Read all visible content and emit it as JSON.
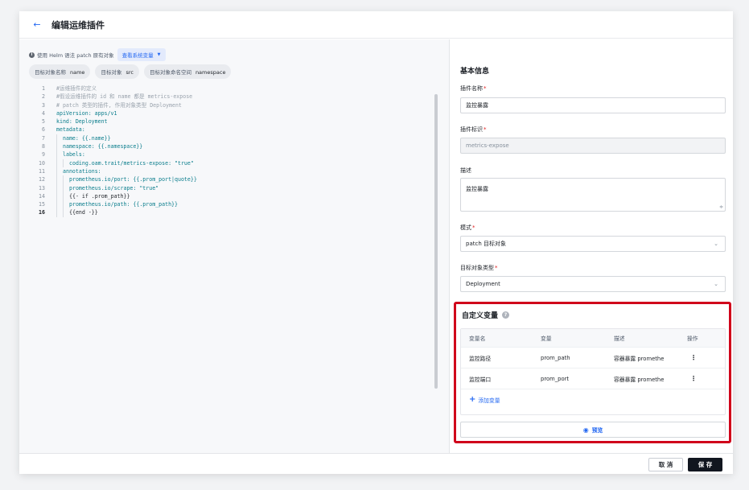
{
  "header": {
    "back_icon": "arrow-left-icon",
    "title": "编辑运维插件"
  },
  "left": {
    "hint": "使用 Helm 语法 patch 原有对象",
    "sysvar_button": "查看系统变量",
    "chips": [
      {
        "label": "目标对象名称",
        "value": "name"
      },
      {
        "label": "目标对象",
        "value": "src"
      },
      {
        "label": "目标对象命名空间",
        "value": "namespace"
      }
    ],
    "code": [
      "#运维插件的定义",
      "#假设运维插件的 id 和 name 都是 metrics-expose",
      "# patch 类型的插件, 作用对象类型 Deployment",
      "apiVersion: apps/v1",
      "kind: Deployment",
      "metadata:",
      "name: {{.name}}",
      "namespace: {{.namespace}}",
      "labels:",
      "coding.oam.trait/metrics-expose: \"true\"",
      "annotations:",
      "prometheus.io/port: {{.prom_port|quote}}",
      "prometheus.io/scrape: \"true\"",
      "{{- if .prom_path}}",
      "prometheus.io/path: {{.prom_path}}",
      "{{end -}}"
    ]
  },
  "right": {
    "section_title": "基本信息",
    "plugin_name_label": "插件名称",
    "plugin_name_value": "监控暴露",
    "plugin_id_label": "插件标识",
    "plugin_id_value": "metrics-expose",
    "desc_label": "描述",
    "desc_value": "监控暴露",
    "mode_label": "模式",
    "mode_value": "patch 目标对象",
    "target_type_label": "目标对象类型",
    "target_type_value": "Deployment",
    "custom_vars": {
      "title": "自定义变量",
      "columns": [
        "变量名",
        "变量",
        "描述",
        "操作"
      ],
      "rows": [
        {
          "name": "监控路径",
          "var": "prom_path",
          "desc": "容器暴露 promethe"
        },
        {
          "name": "监控端口",
          "var": "prom_port",
          "desc": "容器暴露 promethe"
        }
      ],
      "add_label": "添加变量",
      "preview_label": "预览"
    }
  },
  "footer": {
    "cancel_label": "取 消",
    "save_label": "保 存"
  },
  "colors": {
    "accent": "#2468f2",
    "highlight_border": "#d0021b",
    "save_bg": "#11161f"
  }
}
